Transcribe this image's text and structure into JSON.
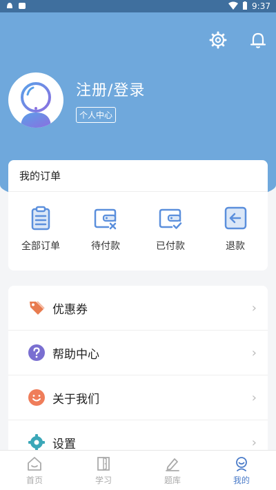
{
  "status_bar": {
    "time": "9:37"
  },
  "profile": {
    "login_label": "注册/登录",
    "badge_label": "个人中心"
  },
  "orders": {
    "title": "我的订单",
    "items": [
      {
        "label": "全部订单",
        "icon": "clipboard-icon"
      },
      {
        "label": "待付款",
        "icon": "wallet-x-icon"
      },
      {
        "label": "已付款",
        "icon": "wallet-check-icon"
      },
      {
        "label": "退款",
        "icon": "return-icon"
      }
    ]
  },
  "menu": {
    "items": [
      {
        "label": "优惠券",
        "icon": "coupon-tag-icon"
      },
      {
        "label": "帮助中心",
        "icon": "help-icon"
      },
      {
        "label": "关于我们",
        "icon": "smile-icon"
      },
      {
        "label": "设置",
        "icon": "settings-gear-icon"
      }
    ]
  },
  "tabs": [
    {
      "label": "首页",
      "icon": "home-icon",
      "active": false
    },
    {
      "label": "学习",
      "icon": "door-icon",
      "active": false
    },
    {
      "label": "题库",
      "icon": "pencil-icon",
      "active": false
    },
    {
      "label": "我的",
      "icon": "profile-icon",
      "active": true
    }
  ],
  "colors": {
    "header_blue": "#6fa8dc",
    "accent_blue": "#4a7bc8",
    "order_icon_blue": "#5b8fdc",
    "coupon_orange": "#e87b4f",
    "help_purple": "#7a6fd1",
    "smile_orange": "#ef7d5a",
    "settings_teal": "#3ba7b8"
  }
}
